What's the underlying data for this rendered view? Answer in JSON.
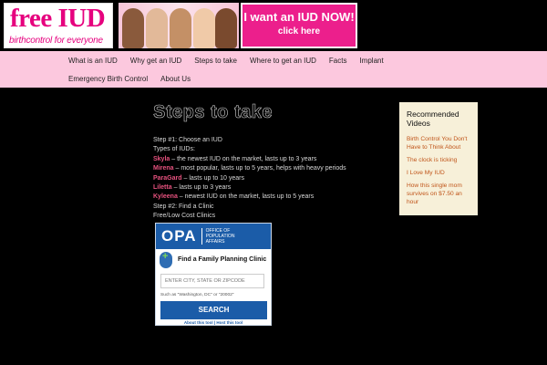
{
  "header": {
    "logo_title": "free IUD",
    "logo_tagline": "birthcontrol for everyone",
    "cta_main": "I want an IUD NOW!",
    "cta_sub": "click here"
  },
  "nav": {
    "row1": [
      "What is an IUD",
      "Why get an IUD",
      "Steps to take",
      "Where to get an IUD",
      "Facts",
      "Implant"
    ],
    "row2": [
      "Emergency Birth Control",
      "About Us"
    ]
  },
  "main": {
    "title": "Steps to take",
    "lines": [
      {
        "pre": "",
        "link": "",
        "text": "Step #1:  Choose an IUD"
      },
      {
        "pre": "",
        "link": "",
        "text": "Types of IUDs:"
      },
      {
        "pre": "",
        "link": "Skyla",
        "text": " – the newest IUD on the market, lasts up to 3 years"
      },
      {
        "pre": "",
        "link": "Mirena",
        "text": " – most popular, lasts up to 5 years, helps with heavy periods"
      },
      {
        "pre": "",
        "link": "ParaGard",
        "text": " – lasts up to 10 years"
      },
      {
        "pre": "",
        "link": "Liletta",
        "text": " – lasts up to 3 years"
      },
      {
        "pre": "",
        "link": "Kyleena",
        "text": " – newest IUD on the market, lasts up to 5 years"
      },
      {
        "pre": "",
        "link": "",
        "text": "Step #2:  Find a Clinic"
      },
      {
        "pre": "",
        "link": "",
        "text": "Free/Low Cost Clinics"
      }
    ]
  },
  "opa_widget": {
    "logo": "OPA",
    "office": "OFFICE OF POPULATION AFFAIRS",
    "find_label": "Find a Family Planning Clinic",
    "input_placeholder": "ENTER CITY, STATE OR ZIPCODE",
    "hint": "Such as \"Washington, DC\" or \"20002\"",
    "search_label": "SEARCH",
    "footer": "About this tool | Host this tool"
  },
  "sidebar": {
    "title": "Recommended Videos",
    "links": [
      "Birth Control You Don't Have to Think About",
      "The clock is ticking",
      "I Love My IUD",
      "How this single mom survives on $7.50 an hour"
    ]
  }
}
